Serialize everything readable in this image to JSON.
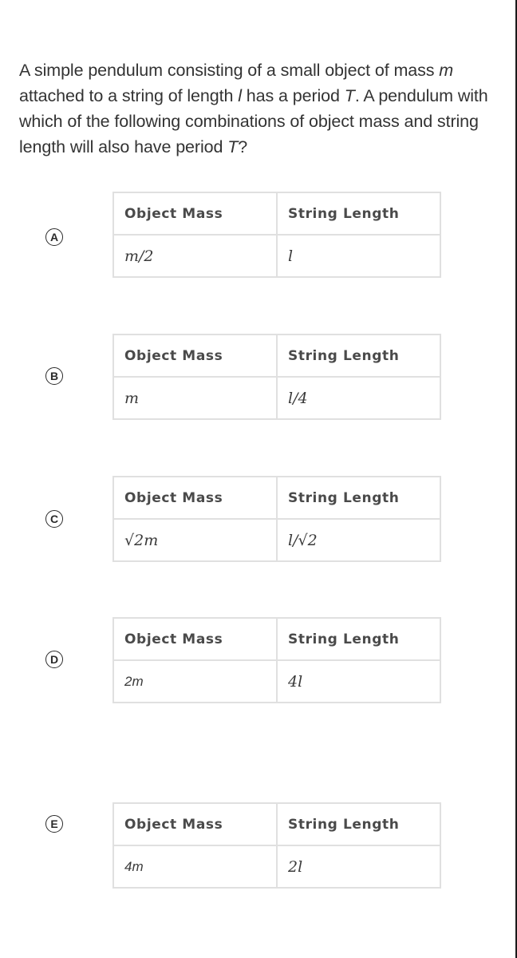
{
  "question": {
    "parts": [
      {
        "text": "A simple pendulum consisting of a small object of mass ",
        "italic": false
      },
      {
        "text": "m",
        "italic": true
      },
      {
        "text": " attached to a string of length ",
        "italic": false
      },
      {
        "text": "l",
        "italic": true
      },
      {
        "text": " has a period ",
        "italic": false
      },
      {
        "text": "T",
        "italic": true
      },
      {
        "text": ". A pendulum with which of the following combinations of object mass and string length will also have period ",
        "italic": false
      },
      {
        "text": "T",
        "italic": true
      },
      {
        "text": "?",
        "italic": false
      }
    ]
  },
  "table_headers": {
    "mass": "Object Mass",
    "length": "String Length"
  },
  "options": [
    {
      "letter": "A",
      "mass": "m/2",
      "length": "l"
    },
    {
      "letter": "B",
      "mass": "m",
      "length": "l/4"
    },
    {
      "letter": "C",
      "mass": "√2m",
      "length": "l/√2"
    },
    {
      "letter": "D",
      "mass": "2m",
      "length": "4l"
    },
    {
      "letter": "E",
      "mass": "4m",
      "length": "2l"
    }
  ]
}
